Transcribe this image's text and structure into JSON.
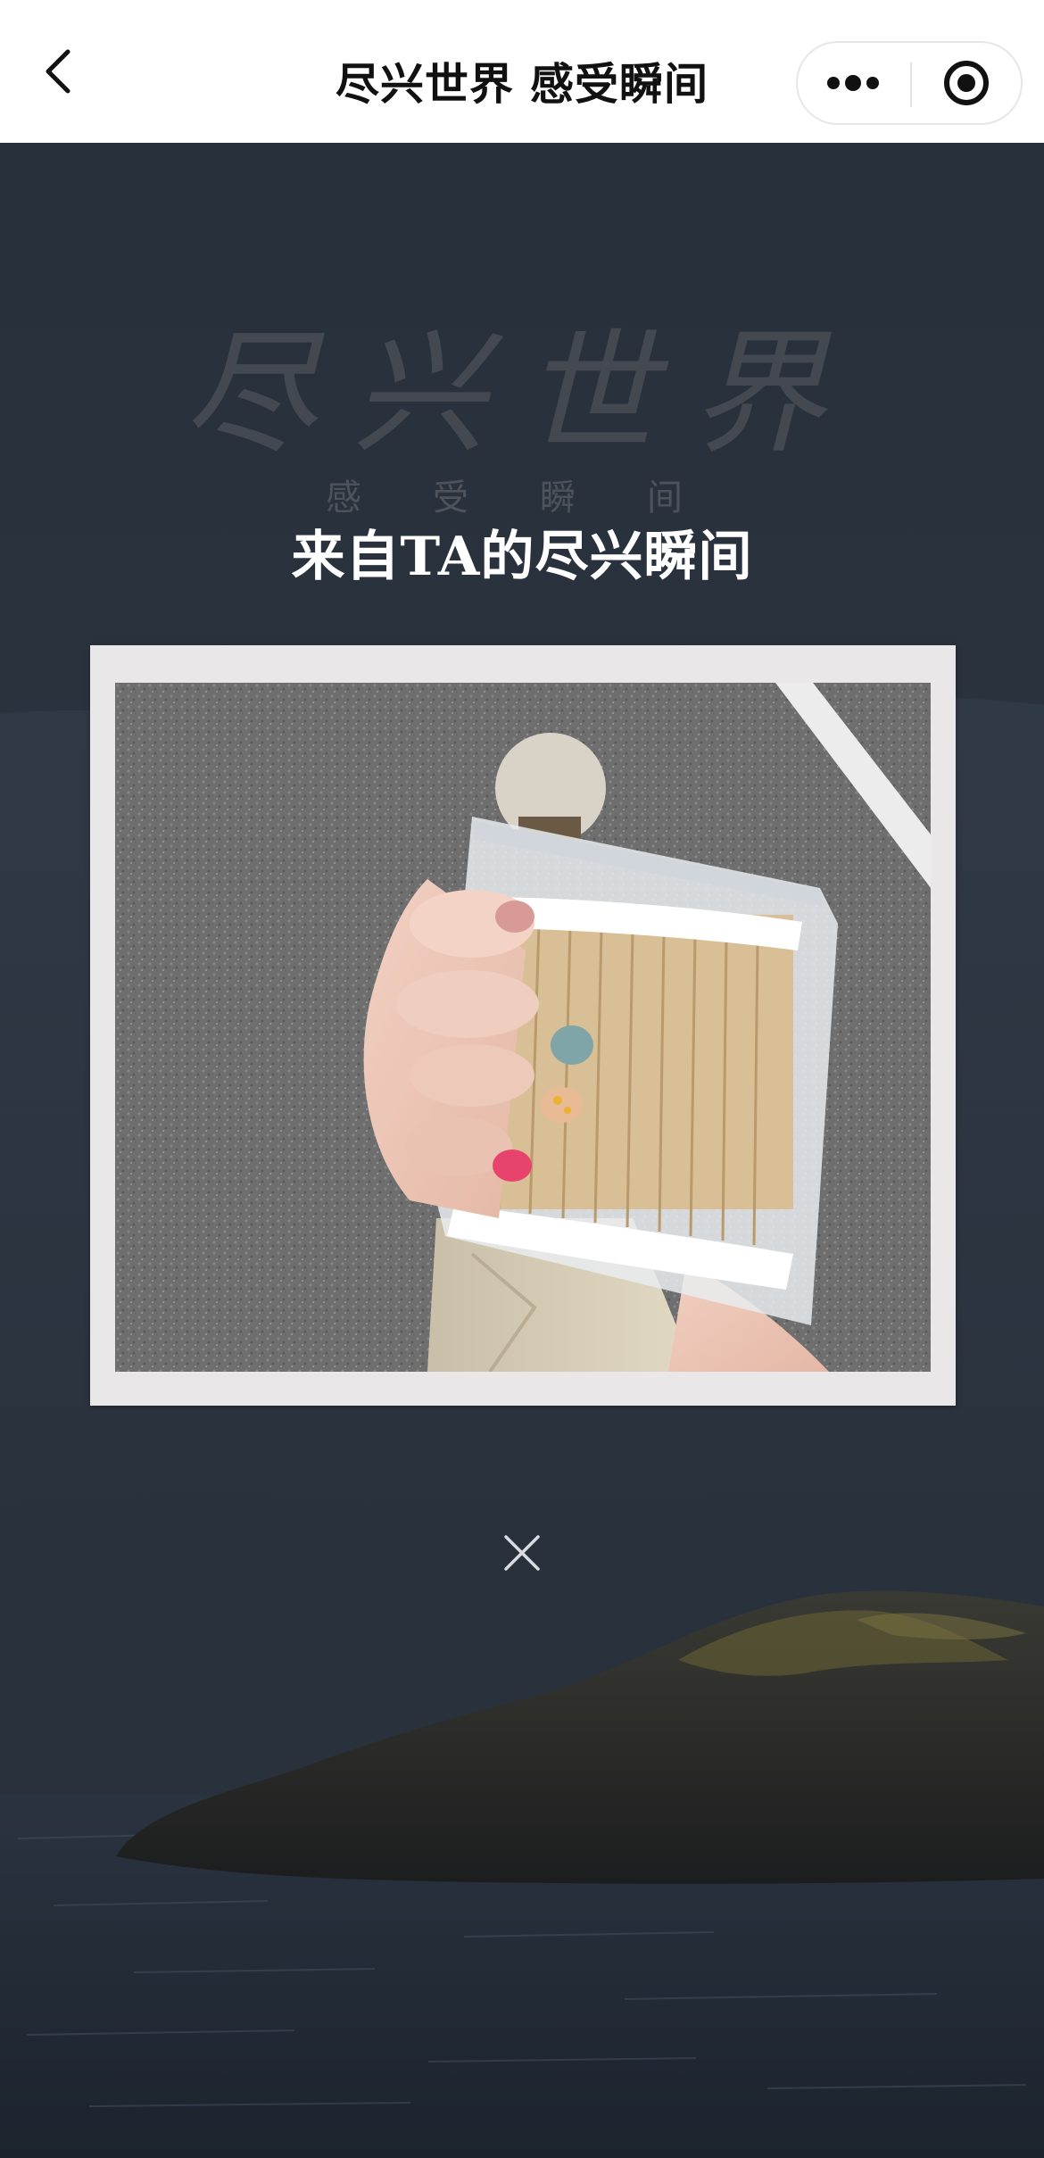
{
  "nav": {
    "back_icon": "chevron-left-icon",
    "title": "尽兴世界 感受瞬间",
    "more_icon": "more-dots-icon",
    "close_icon": "target-circle-icon"
  },
  "hero": {
    "title": "尽兴世界",
    "subtitle": "感受瞬间"
  },
  "caption": "来自TA的尽兴瞬间",
  "photo": {
    "subject": "hand-holding-cotton-swabs-photo"
  },
  "dismiss": {
    "icon": "close-icon"
  },
  "colors": {
    "nav_bg": "#ffffff",
    "scene_bg": "#28303c",
    "frame": "#e9e7e7",
    "caption_text": "#ffffff"
  }
}
